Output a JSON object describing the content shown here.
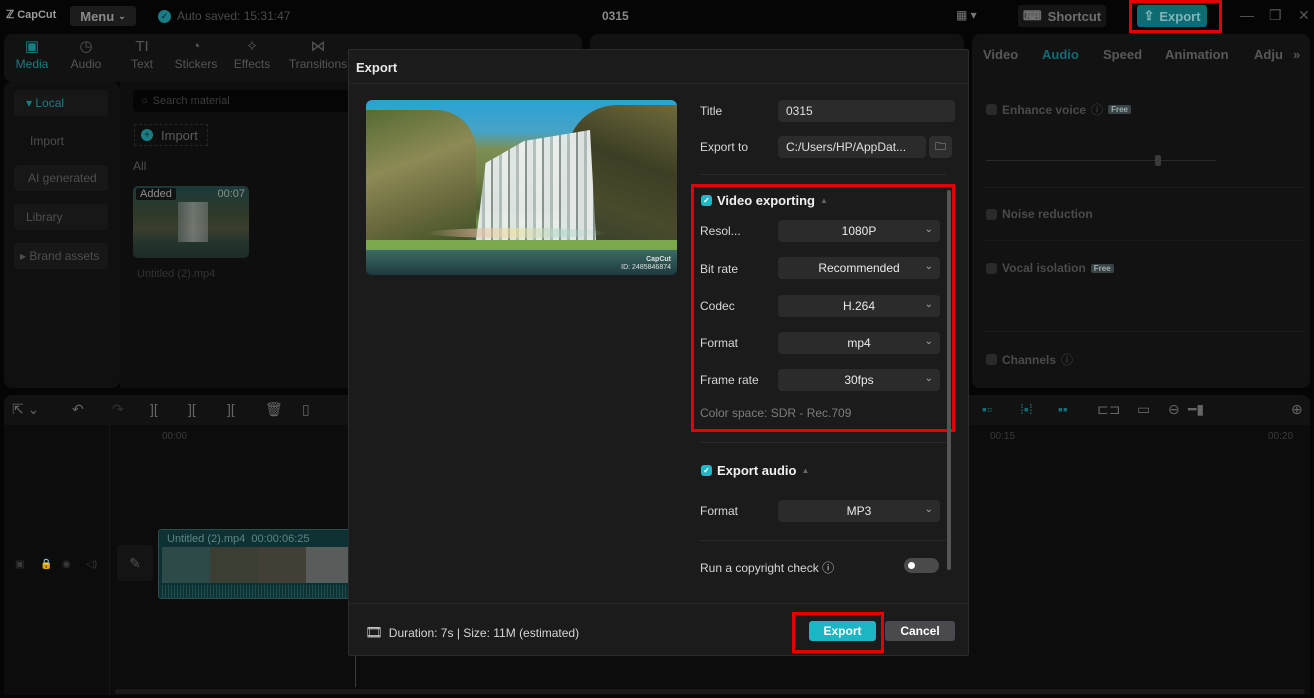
{
  "titlebar": {
    "logo": "CapCut",
    "menu_label": "Menu",
    "autosave": "Auto saved: 15:31:47",
    "project_title": "0315",
    "shortcut_label": "Shortcut",
    "export_label": "Export"
  },
  "toolbar": {
    "tools": [
      {
        "label": "Media",
        "icon": "media-icon"
      },
      {
        "label": "Audio",
        "icon": "audio-icon"
      },
      {
        "label": "Text",
        "icon": "text-icon"
      },
      {
        "label": "Stickers",
        "icon": "stickers-icon"
      },
      {
        "label": "Effects",
        "icon": "effects-icon"
      },
      {
        "label": "Transitions",
        "icon": "transitions-icon"
      }
    ]
  },
  "sidebar": {
    "items": [
      {
        "label": "▾ Local"
      },
      {
        "label": "Import"
      },
      {
        "label": "AI generated"
      },
      {
        "label": "Library"
      },
      {
        "label": "▸ Brand assets"
      }
    ]
  },
  "media": {
    "search_placeholder": "Search material",
    "import_label": "Import",
    "filter_label": "All",
    "clip": {
      "badge": "Added",
      "duration": "00:07",
      "name": "Untitled (2).mp4"
    }
  },
  "inspector": {
    "tabs": [
      "Video",
      "Audio",
      "Speed",
      "Animation",
      "Adju"
    ],
    "active_tab": "Audio",
    "rows": [
      {
        "label": "Enhance voice",
        "badge": "Free"
      },
      {
        "label": "Noise reduction"
      },
      {
        "label": "Vocal isolation",
        "badge": "Free"
      },
      {
        "label": "Channels"
      }
    ]
  },
  "timeline": {
    "ruler": [
      "00:00",
      "00:15",
      "00:20"
    ],
    "clip": {
      "name": "Untitled (2).mp4",
      "duration": "00:00:06:25"
    }
  },
  "export_dialog": {
    "title": "Export",
    "watermark": "CapCut",
    "watermark_id": "ID: 2485846874",
    "fields": {
      "title_label": "Title",
      "title_value": "0315",
      "export_to_label": "Export to",
      "export_to_value": "C:/Users/HP/AppDat..."
    },
    "video": {
      "section_label": "Video exporting",
      "checked": true,
      "settings": [
        {
          "label": "Resol...",
          "value": "1080P"
        },
        {
          "label": "Bit rate",
          "value": "Recommended"
        },
        {
          "label": "Codec",
          "value": "H.264"
        },
        {
          "label": "Format",
          "value": "mp4"
        },
        {
          "label": "Frame rate",
          "value": "30fps"
        }
      ],
      "color_space": "Color space: SDR - Rec.709"
    },
    "audio": {
      "section_label": "Export audio",
      "checked": true,
      "format_label": "Format",
      "format_value": "MP3"
    },
    "copyright_label": "Run a copyright check",
    "copyright_enabled": false,
    "footer_info": "Duration: 7s | Size: 11M (estimated)",
    "export_button": "Export",
    "cancel_button": "Cancel"
  },
  "colors": {
    "accent": "#1cb5c4",
    "highlight": "#e60000"
  }
}
